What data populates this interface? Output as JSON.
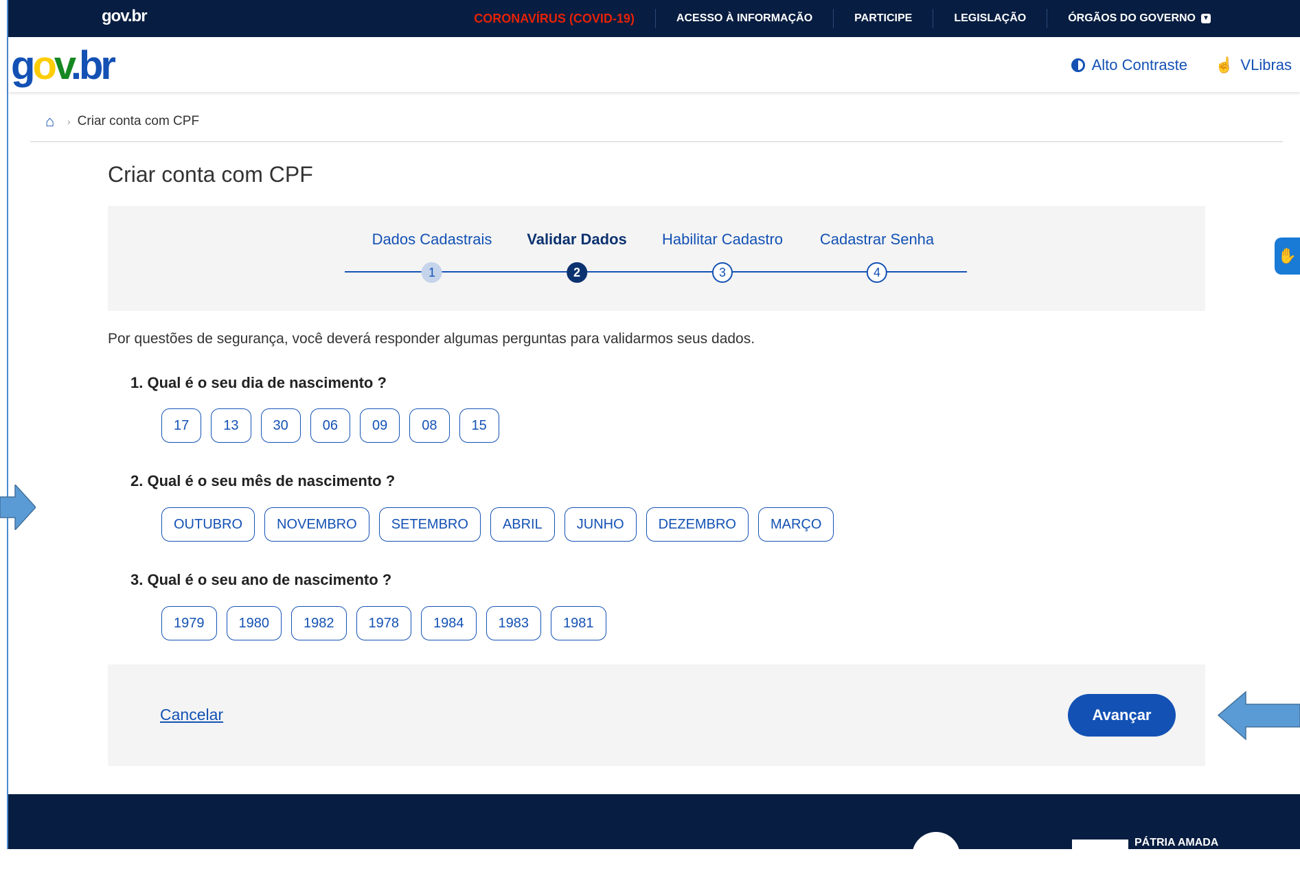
{
  "topbar": {
    "logo": "gov.br",
    "nav": [
      "CORONAVÍRUS (COVID-19)",
      "ACESSO À INFORMAÇÃO",
      "PARTICIPE",
      "LEGISLAÇÃO",
      "ÓRGÃOS DO GOVERNO"
    ]
  },
  "header": {
    "brand": "gov.br",
    "tools": {
      "contrast": "Alto Contraste",
      "vlibras": "VLibras"
    }
  },
  "breadcrumb": {
    "current": "Criar conta com CPF"
  },
  "page": {
    "title": "Criar conta com CPF",
    "intro": "Por questões de segurança, você deverá responder algumas perguntas para validarmos seus dados."
  },
  "stepper": {
    "steps": [
      {
        "label": "Dados Cadastrais",
        "number": "1",
        "state": "done"
      },
      {
        "label": "Validar Dados",
        "number": "2",
        "state": "current"
      },
      {
        "label": "Habilitar Cadastro",
        "number": "3",
        "state": "pending"
      },
      {
        "label": "Cadastrar Senha",
        "number": "4",
        "state": "pending"
      }
    ]
  },
  "questions": [
    {
      "text": "1. Qual é o seu dia de nascimento ?",
      "options": [
        "17",
        "13",
        "30",
        "06",
        "09",
        "08",
        "15"
      ]
    },
    {
      "text": "2. Qual é o seu mês de nascimento ?",
      "options": [
        "OUTUBRO",
        "NOVEMBRO",
        "SETEMBRO",
        "ABRIL",
        "JUNHO",
        "DEZEMBRO",
        "MARÇO"
      ]
    },
    {
      "text": "3. Qual é o seu ano de nascimento ?",
      "options": [
        "1979",
        "1980",
        "1982",
        "1978",
        "1984",
        "1983",
        "1981"
      ]
    }
  ],
  "actions": {
    "cancel": "Cancelar",
    "advance": "Avançar"
  },
  "footer": {
    "patria": "PÁTRIA AMADA"
  },
  "colors": {
    "primary": "#1351b4",
    "dark_navy": "#071d41",
    "covid_red": "#e52207",
    "arrow_blue": "#5b9bd5"
  }
}
